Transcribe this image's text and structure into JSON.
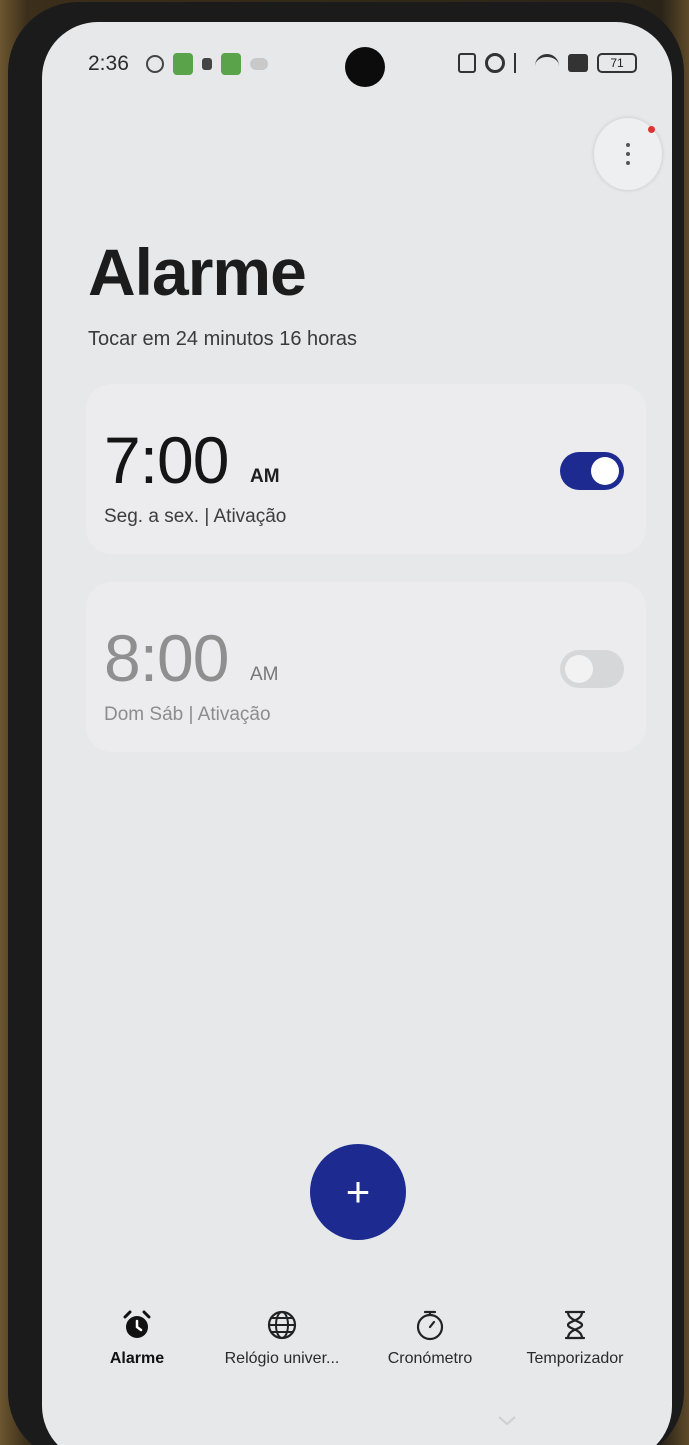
{
  "status_bar": {
    "time": "2:36",
    "battery": "71"
  },
  "header": {
    "title": "Alarme",
    "subtitle": "Tocar em 24 minutos 16 horas"
  },
  "alarms": [
    {
      "time": "7:00",
      "ampm": "AM",
      "days": "Seg. a sex. | Ativação",
      "enabled": true
    },
    {
      "time": "8:00",
      "ampm": "AM",
      "days": "Dom Sáb | Ativação",
      "enabled": false
    }
  ],
  "fab": {
    "icon": "plus-icon",
    "label": "+"
  },
  "nav": {
    "items": [
      {
        "label": "Alarme",
        "icon": "alarm-clock-icon",
        "active": true
      },
      {
        "label": "Relógio univer...",
        "icon": "globe-icon",
        "active": false
      },
      {
        "label": "Cronómetro",
        "icon": "stopwatch-icon",
        "active": false
      },
      {
        "label": "Temporizador",
        "icon": "hourglass-icon",
        "active": false
      }
    ]
  },
  "colors": {
    "accent": "#1d2b90",
    "background": "#e7e8ea",
    "card": "#ececee"
  }
}
